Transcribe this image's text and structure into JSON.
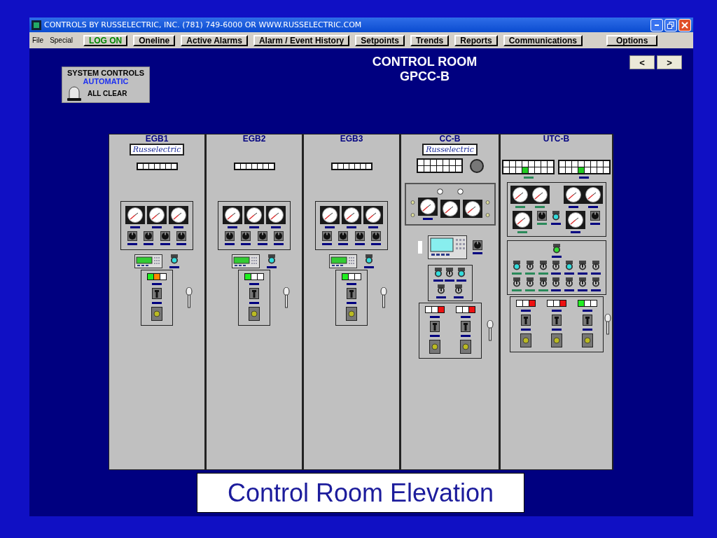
{
  "slide": {
    "caption": "Control Room Elevation"
  },
  "window": {
    "title": "CONTROLS BY RUSSELECTRIC, INC. (781) 749-6000 OR WWW.RUSSELECTRIC.COM"
  },
  "menu": [
    "File",
    "Special"
  ],
  "toolbar": [
    {
      "label": "LOG ON",
      "kind": "login"
    },
    {
      "label": "Oneline",
      "kind": "nav"
    },
    {
      "label": "Active Alarms",
      "kind": "nav"
    },
    {
      "label": "Alarm / Event History",
      "kind": "nav"
    },
    {
      "label": "Setpoints",
      "kind": "nav"
    },
    {
      "label": "Trends",
      "kind": "nav"
    },
    {
      "label": "Reports",
      "kind": "nav"
    },
    {
      "label": "Communications",
      "kind": "nav"
    },
    {
      "label": "Options",
      "kind": "options"
    }
  ],
  "nav_buttons": [
    "<",
    ">"
  ],
  "system_controls": {
    "title": "SYSTEM CONTROLS",
    "mode": "AUTOMATIC",
    "alarm": "ALL CLEAR"
  },
  "heading": [
    "CONTROL ROOM",
    "GPCC-B"
  ],
  "cabinets": [
    {
      "name": "EGB1",
      "kind": "generator",
      "logo": "Russelectric",
      "annunciators": [
        {
          "cells": [
            [
              {
                "color": "#ffffff"
              },
              {
                "color": "#ffffff"
              },
              {
                "color": "#ffffff"
              },
              {
                "color": "#ffffff"
              },
              {
                "color": "#ffffff"
              },
              {
                "color": "#ffffff"
              },
              {
                "color": "#ffffff"
              }
            ]
          ]
        }
      ],
      "breakers": [
        {
          "lights": [
            {
              "color": "#22ee22"
            },
            {
              "color": "#ff8800"
            },
            {
              "color": "#ffffff"
            }
          ]
        }
      ]
    },
    {
      "name": "EGB2",
      "kind": "generator",
      "annunciators": [
        {
          "cells": [
            [
              {
                "color": "#ffffff"
              },
              {
                "color": "#ffffff"
              },
              {
                "color": "#ffffff"
              },
              {
                "color": "#ffffff"
              },
              {
                "color": "#ffffff"
              },
              {
                "color": "#ffffff"
              },
              {
                "color": "#ffffff"
              }
            ]
          ]
        }
      ],
      "breakers": [
        {
          "lights": [
            {
              "color": "#22ee22"
            },
            {
              "color": "#ffffff"
            },
            {
              "color": "#ffffff"
            }
          ]
        }
      ]
    },
    {
      "name": "EGB3",
      "kind": "generator",
      "annunciators": [
        {
          "cells": [
            [
              {
                "color": "#ffffff"
              },
              {
                "color": "#ffffff"
              },
              {
                "color": "#ffffff"
              },
              {
                "color": "#ffffff"
              },
              {
                "color": "#ffffff"
              },
              {
                "color": "#ffffff"
              },
              {
                "color": "#ffffff"
              }
            ]
          ]
        }
      ],
      "breakers": [
        {
          "lights": [
            {
              "color": "#22ee22"
            },
            {
              "color": "#ffffff"
            },
            {
              "color": "#ffffff"
            }
          ]
        }
      ]
    },
    {
      "name": "CC-B",
      "kind": "control",
      "logo": "Russelectric",
      "annunciators": [
        {
          "cells": [
            [
              {
                "color": "#ffffff"
              },
              {
                "color": "#ffffff"
              },
              {
                "color": "#ffffff"
              },
              {
                "color": "#ffffff"
              },
              {
                "color": "#ffffff"
              },
              {
                "color": "#ffffff"
              },
              {
                "color": "#ffffff"
              }
            ],
            [
              {
                "color": "#ffffff"
              },
              {
                "color": "#ffffff"
              },
              {
                "color": "#ffffff"
              },
              {
                "color": "#ffffff"
              },
              {
                "color": "#ffffff"
              },
              {
                "color": "#ffffff"
              },
              {
                "color": "#ffffff"
              }
            ]
          ]
        }
      ],
      "breakers": [
        {
          "lights": [
            {
              "color": "#ffffff"
            },
            {
              "color": "#ffffff"
            },
            {
              "color": "#ee1111"
            }
          ]
        },
        {
          "lights": [
            {
              "color": "#ffffff"
            },
            {
              "color": "#ffffff"
            },
            {
              "color": "#ee1111"
            }
          ]
        }
      ]
    },
    {
      "name": "UTC-B",
      "kind": "utility",
      "annunciators": [
        {
          "cells": [
            [
              {
                "color": "#ffffff"
              },
              {
                "color": "#ffffff"
              },
              {
                "color": "#ffffff"
              },
              {
                "color": "#ffffff"
              },
              {
                "color": "#ffffff"
              },
              {
                "color": "#ffffff"
              },
              {
                "color": "#ffffff"
              },
              {
                "color": "#ffffff"
              }
            ],
            [
              {
                "color": "#ffffff"
              },
              {
                "color": "#ffffff"
              },
              {
                "color": "#ffffff"
              },
              {
                "color": "#22cc22"
              },
              {
                "color": "#ffffff"
              },
              {
                "color": "#ffffff"
              },
              {
                "color": "#ffffff"
              },
              {
                "color": "#ffffff"
              }
            ]
          ]
        },
        {
          "cells": [
            [
              {
                "color": "#ffffff"
              },
              {
                "color": "#ffffff"
              },
              {
                "color": "#ffffff"
              },
              {
                "color": "#ffffff"
              },
              {
                "color": "#ffffff"
              },
              {
                "color": "#ffffff"
              },
              {
                "color": "#ffffff"
              },
              {
                "color": "#ffffff"
              }
            ],
            [
              {
                "color": "#ffffff"
              },
              {
                "color": "#ffffff"
              },
              {
                "color": "#ffffff"
              },
              {
                "color": "#22cc22"
              },
              {
                "color": "#ffffff"
              },
              {
                "color": "#ffffff"
              },
              {
                "color": "#ffffff"
              },
              {
                "color": "#ffffff"
              }
            ]
          ]
        }
      ],
      "breakers": [
        {
          "lights": [
            {
              "color": "#ffffff"
            },
            {
              "color": "#ffffff"
            },
            {
              "color": "#ee1111"
            }
          ]
        },
        {
          "lights": [
            {
              "color": "#ffffff"
            },
            {
              "color": "#ffffff"
            },
            {
              "color": "#ee1111"
            }
          ]
        },
        {
          "lights": [
            {
              "color": "#22ee22"
            },
            {
              "color": "#ffffff"
            },
            {
              "color": "#ffffff"
            }
          ]
        }
      ]
    }
  ]
}
